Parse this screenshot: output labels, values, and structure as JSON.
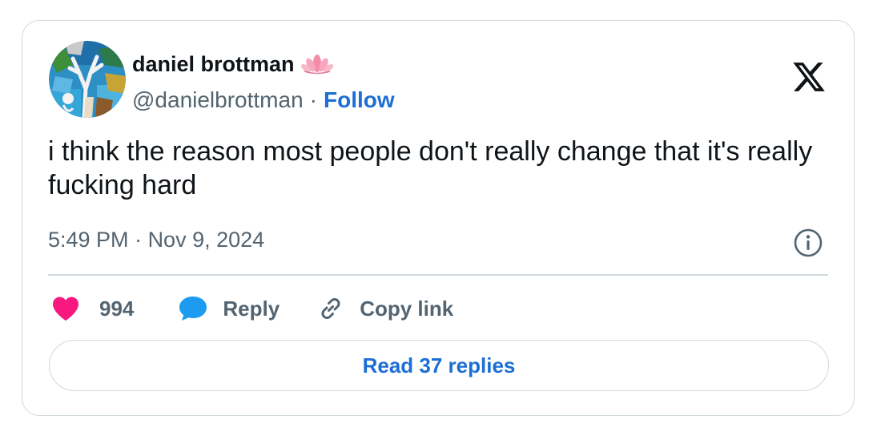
{
  "tweet": {
    "author_name": "daniel brottman",
    "author_emoji": "lotus-icon",
    "handle": "@danielbrottman",
    "separator": "·",
    "follow_label": "Follow",
    "text": "i think the reason most people don't really change that it's really fucking hard",
    "time": "5:49 PM",
    "date": "Nov 9, 2024",
    "meta_separator": " · "
  },
  "actions": {
    "likes_count": "994",
    "reply_label": "Reply",
    "copy_label": "Copy link"
  },
  "footer": {
    "read_replies_label": "Read 37 replies"
  },
  "colors": {
    "link_blue": "#1d6ed4",
    "like_pink": "#f91880",
    "reply_blue": "#1d9bf0",
    "muted_text": "#536471",
    "border": "#cfd9de"
  }
}
